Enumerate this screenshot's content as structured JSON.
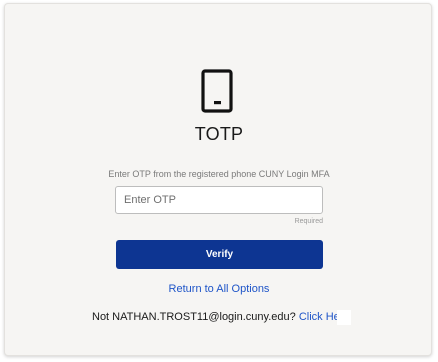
{
  "title": "TOTP",
  "icons": {
    "device": "phone-icon"
  },
  "prompt": "Enter OTP from the registered phone CUNY Login MFA",
  "otp_field": {
    "placeholder": "Enter OTP",
    "value": "",
    "required_label": "Required"
  },
  "verify_label": "Verify",
  "return_label": "Return to All Options",
  "not_user": {
    "prefix": "Not NATHAN.TROST11@login.cuny.edu?",
    "link_label": "Click Here"
  },
  "colors": {
    "primary": "#0d3592",
    "link": "#1f55c8",
    "card_background": "#f6f5f3"
  }
}
